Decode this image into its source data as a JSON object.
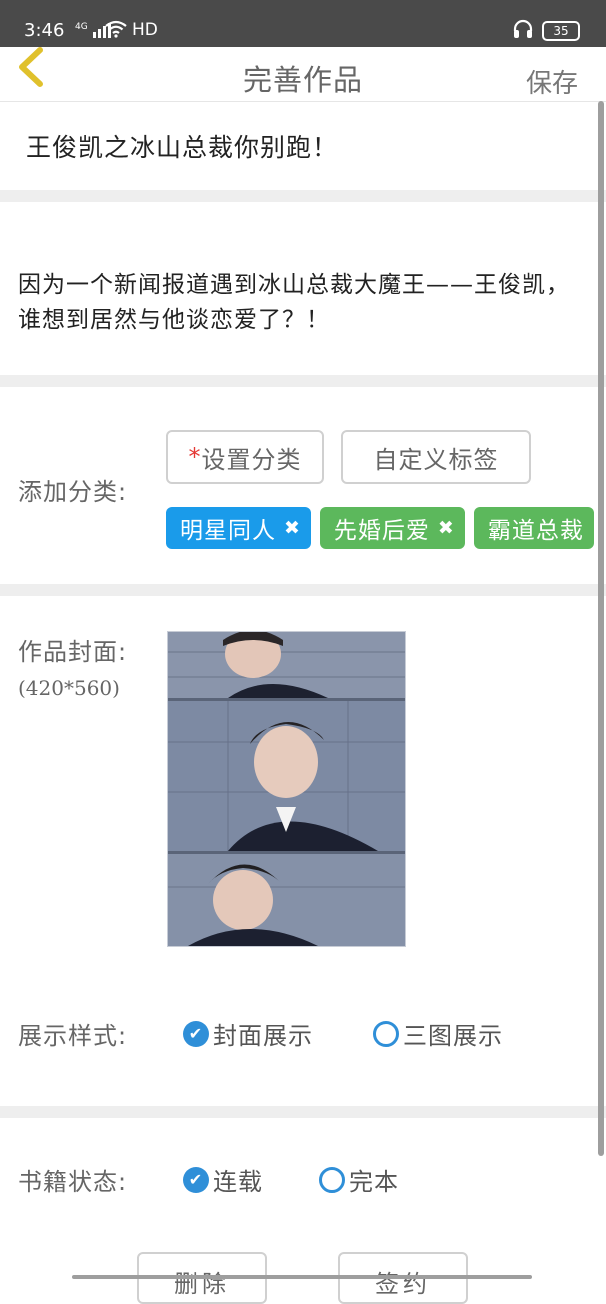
{
  "status_bar": {
    "time": "3:46",
    "network": "4G",
    "hd": "HD",
    "battery": "35"
  },
  "navbar": {
    "title": "完善作品",
    "save_label": "保存"
  },
  "book": {
    "title": "王俊凯之冰山总裁你别跑！",
    "description": "因为一个新闻报道遇到冰山总裁大魔王——王俊凯，谁想到居然与他谈恋爱了？！"
  },
  "category": {
    "label": "添加分类:",
    "set_category_star": "*",
    "set_category_label": "设置分类",
    "custom_tag_label": "自定义标签",
    "tags": [
      {
        "name": "明星同人",
        "color": "#1a9bea"
      },
      {
        "name": "先婚后爱",
        "color": "#5cb85c"
      },
      {
        "name": "霸道总裁",
        "color": "#5cb85c"
      }
    ],
    "tag_remove_glyph": "✖"
  },
  "cover": {
    "label": "作品封面:",
    "size_hint": "(420*560)"
  },
  "display_style": {
    "label": "展示样式:",
    "options": [
      {
        "label": "封面展示",
        "selected": true
      },
      {
        "label": "三图展示",
        "selected": false
      }
    ]
  },
  "book_status": {
    "label": "书籍状态:",
    "options": [
      {
        "label": "连载",
        "selected": true
      },
      {
        "label": "完本",
        "selected": false
      }
    ]
  },
  "actions": {
    "delete_label": "删除",
    "sign_label": "签约"
  },
  "colors": {
    "accent_blue": "#2f8fd8",
    "tag_blue": "#1a9bea",
    "tag_green": "#5cb85c"
  }
}
